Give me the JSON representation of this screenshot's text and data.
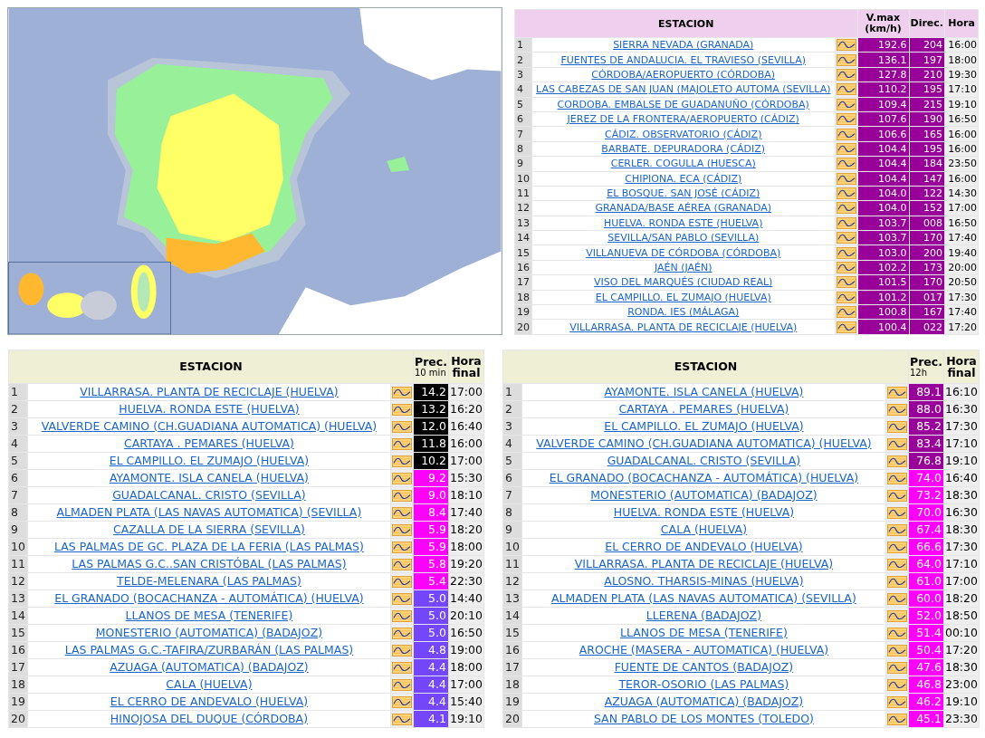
{
  "tables": [
    {
      "kind": "wind",
      "columns": [
        {
          "label": "ESTACION"
        },
        {
          "label": "V.max",
          "sub": "(km/h)"
        },
        {
          "label": "Direc."
        },
        {
          "label": "Hora"
        }
      ],
      "rows": [
        {
          "n": "1",
          "station": "SIERRA NEVADA (GRANADA)",
          "value": "192.6",
          "dir": "204",
          "time": "16:00",
          "color": "#990099"
        },
        {
          "n": "2",
          "station": "FUENTES DE ANDALUCIA. EL TRAVIESO (SEVILLA)",
          "value": "136.1",
          "dir": "197",
          "time": "18:00",
          "color": "#990099"
        },
        {
          "n": "3",
          "station": "CÓRDOBA/AEROPUERTO (CÓRDOBA)",
          "value": "127.8",
          "dir": "210",
          "time": "19:30",
          "color": "#990099"
        },
        {
          "n": "4",
          "station": "LAS CABEZAS DE SAN JUAN (MAJOLETO AUTOMA (SEVILLA)",
          "value": "110.2",
          "dir": "195",
          "time": "17:10",
          "color": "#990099"
        },
        {
          "n": "5",
          "station": "CORDOBA. EMBALSE DE GUADANUÑO (CÓRDOBA)",
          "value": "109.4",
          "dir": "215",
          "time": "19:10",
          "color": "#990099"
        },
        {
          "n": "6",
          "station": "JEREZ DE LA FRONTERA/AEROPUERTO (CÁDIZ)",
          "value": "107.6",
          "dir": "190",
          "time": "16:50",
          "color": "#990099"
        },
        {
          "n": "7",
          "station": "CÁDIZ. OBSERVATORIO (CÁDIZ)",
          "value": "106.6",
          "dir": "165",
          "time": "16:00",
          "color": "#990099"
        },
        {
          "n": "8",
          "station": "BARBATE. DEPURADORA (CÁDIZ)",
          "value": "104.4",
          "dir": "195",
          "time": "16:00",
          "color": "#990099"
        },
        {
          "n": "9",
          "station": "CERLER. COGULLA (HUESCA)",
          "value": "104.4",
          "dir": "184",
          "time": "23:50",
          "color": "#990099"
        },
        {
          "n": "10",
          "station": "CHIPIONA. ECA (CÁDIZ)",
          "value": "104.4",
          "dir": "147",
          "time": "16:00",
          "color": "#990099"
        },
        {
          "n": "11",
          "station": "EL BOSQUE. SAN JOSÉ (CÁDIZ)",
          "value": "104.0",
          "dir": "122",
          "time": "14:30",
          "color": "#990099"
        },
        {
          "n": "12",
          "station": "GRANADA/BASE AÉREA (GRANADA)",
          "value": "104.0",
          "dir": "152",
          "time": "17:00",
          "color": "#990099"
        },
        {
          "n": "13",
          "station": "HUELVA. RONDA ESTE (HUELVA)",
          "value": "103.7",
          "dir": "008",
          "time": "16:50",
          "color": "#990099"
        },
        {
          "n": "14",
          "station": "SEVILLA/SAN PABLO (SEVILLA)",
          "value": "103.7",
          "dir": "170",
          "time": "17:40",
          "color": "#990099"
        },
        {
          "n": "15",
          "station": "VILLANUEVA DE CÓRDOBA (CÓRDOBA)",
          "value": "103.0",
          "dir": "200",
          "time": "19:40",
          "color": "#990099"
        },
        {
          "n": "16",
          "station": "JAÉN (JAÉN)",
          "value": "102.2",
          "dir": "173",
          "time": "20:00",
          "color": "#990099"
        },
        {
          "n": "17",
          "station": "VISO DEL MARQUÉS (CIUDAD REAL)",
          "value": "101.5",
          "dir": "170",
          "time": "20:50",
          "color": "#990099"
        },
        {
          "n": "18",
          "station": "EL CAMPILLO. EL ZUMAJO (HUELVA)",
          "value": "101.2",
          "dir": "017",
          "time": "17:30",
          "color": "#990099"
        },
        {
          "n": "19",
          "station": "RONDA. IES (MÁLAGA)",
          "value": "100.8",
          "dir": "167",
          "time": "17:40",
          "color": "#990099"
        },
        {
          "n": "20",
          "station": "VILLARRASA. PLANTA DE RECICLAJE (HUELVA)",
          "value": "100.4",
          "dir": "022",
          "time": "17:20",
          "color": "#990099"
        }
      ]
    },
    {
      "kind": "precip",
      "columns": [
        {
          "label": "ESTACION"
        },
        {
          "label": "Prec.",
          "sub": "10 min"
        },
        {
          "label": "Hora final"
        }
      ],
      "rows": [
        {
          "n": "1",
          "station": "VILLARRASA. PLANTA DE RECICLAJE (HUELVA)",
          "value": "14.2",
          "time": "17:00",
          "color": "#000000"
        },
        {
          "n": "2",
          "station": "HUELVA. RONDA ESTE (HUELVA)",
          "value": "13.2",
          "time": "16:20",
          "color": "#000000"
        },
        {
          "n": "3",
          "station": "VALVERDE CAMINO (CH.GUADIANA AUTOMATICA) (HUELVA)",
          "value": "12.0",
          "time": "16:40",
          "color": "#000000"
        },
        {
          "n": "4",
          "station": "CARTAYA . PEMARES (HUELVA)",
          "value": "11.8",
          "time": "16:00",
          "color": "#000000"
        },
        {
          "n": "5",
          "station": "EL CAMPILLO. EL ZUMAJO (HUELVA)",
          "value": "10.2",
          "time": "17:00",
          "color": "#000000"
        },
        {
          "n": "6",
          "station": "AYAMONTE. ISLA CANELA (HUELVA)",
          "value": "9.2",
          "time": "15:30",
          "color": "#ff00ff"
        },
        {
          "n": "7",
          "station": "GUADALCANAL. CRISTO (SEVILLA)",
          "value": "9.0",
          "time": "18:10",
          "color": "#ff00ff"
        },
        {
          "n": "8",
          "station": "ALMADEN PLATA (LAS NAVAS AUTOMATICA) (SEVILLA)",
          "value": "8.4",
          "time": "17:40",
          "color": "#ff00ff"
        },
        {
          "n": "9",
          "station": "CAZALLA DE LA SIERRA (SEVILLA)",
          "value": "5.9",
          "time": "18:20",
          "color": "#ff00ff"
        },
        {
          "n": "10",
          "station": "LAS PALMAS DE GC. PLAZA DE LA FERIA (LAS PALMAS)",
          "value": "5.9",
          "time": "18:00",
          "color": "#ff00ff"
        },
        {
          "n": "11",
          "station": "LAS PALMAS G.C..SAN CRISTÓBAL (LAS PALMAS)",
          "value": "5.8",
          "time": "19:20",
          "color": "#ff00ff"
        },
        {
          "n": "12",
          "station": "TELDE-MELENARA (LAS PALMAS)",
          "value": "5.4",
          "time": "22:30",
          "color": "#ff00ff"
        },
        {
          "n": "13",
          "station": "EL GRANADO (BOCACHANZA - AUTOMÁTICA) (HUELVA)",
          "value": "5.0",
          "time": "14:40",
          "color": "#7447ff"
        },
        {
          "n": "14",
          "station": "LLANOS DE MESA (TENERIFE)",
          "value": "5.0",
          "time": "20:10",
          "color": "#7447ff"
        },
        {
          "n": "15",
          "station": "MONESTERIO (AUTOMATICA) (BADAJOZ)",
          "value": "5.0",
          "time": "16:50",
          "color": "#7447ff"
        },
        {
          "n": "16",
          "station": "LAS PALMAS G.C.-TAFIRA/ZURBARÁN (LAS PALMAS)",
          "value": "4.8",
          "time": "19:00",
          "color": "#7447ff"
        },
        {
          "n": "17",
          "station": "AZUAGA (AUTOMATICA) (BADAJOZ)",
          "value": "4.4",
          "time": "18:00",
          "color": "#7447ff"
        },
        {
          "n": "18",
          "station": "CALA (HUELVA)",
          "value": "4.4",
          "time": "17:00",
          "color": "#7447ff"
        },
        {
          "n": "19",
          "station": "EL CERRO DE ANDEVALO (HUELVA)",
          "value": "4.4",
          "time": "15:40",
          "color": "#7447ff"
        },
        {
          "n": "20",
          "station": "HINOJOSA DEL DUQUE (CÓRDOBA)",
          "value": "4.1",
          "time": "19:10",
          "color": "#7447ff"
        }
      ]
    },
    {
      "kind": "precip",
      "columns": [
        {
          "label": "ESTACION"
        },
        {
          "label": "Prec.",
          "sub": "12h"
        },
        {
          "label": "Hora final"
        }
      ],
      "rows": [
        {
          "n": "1",
          "station": "AYAMONTE. ISLA CANELA (HUELVA)",
          "value": "89.1",
          "time": "16:10",
          "color": "#990099"
        },
        {
          "n": "2",
          "station": "CARTAYA . PEMARES (HUELVA)",
          "value": "88.0",
          "time": "16:30",
          "color": "#990099"
        },
        {
          "n": "3",
          "station": "EL CAMPILLO. EL ZUMAJO (HUELVA)",
          "value": "85.2",
          "time": "17:30",
          "color": "#990099"
        },
        {
          "n": "4",
          "station": "VALVERDE CAMINO (CH.GUADIANA AUTOMATICA) (HUELVA)",
          "value": "83.4",
          "time": "17:10",
          "color": "#990099"
        },
        {
          "n": "5",
          "station": "GUADALCANAL. CRISTO (SEVILLA)",
          "value": "76.8",
          "time": "19:10",
          "color": "#990099"
        },
        {
          "n": "6",
          "station": "EL GRANADO (BOCACHANZA - AUTOMÁTICA) (HUELVA)",
          "value": "74.0",
          "time": "16:40",
          "color": "#ff00ff"
        },
        {
          "n": "7",
          "station": "MONESTERIO (AUTOMATICA) (BADAJOZ)",
          "value": "73.2",
          "time": "18:30",
          "color": "#ff00ff"
        },
        {
          "n": "8",
          "station": "HUELVA. RONDA ESTE (HUELVA)",
          "value": "70.0",
          "time": "16:30",
          "color": "#ff00ff"
        },
        {
          "n": "9",
          "station": "CALA (HUELVA)",
          "value": "67.4",
          "time": "18:30",
          "color": "#ff00ff"
        },
        {
          "n": "10",
          "station": "EL CERRO DE ANDEVALO (HUELVA)",
          "value": "66.6",
          "time": "17:30",
          "color": "#ff00ff"
        },
        {
          "n": "11",
          "station": "VILLARRASA. PLANTA DE RECICLAJE (HUELVA)",
          "value": "64.0",
          "time": "17:10",
          "color": "#ff00ff"
        },
        {
          "n": "12",
          "station": "ALOSNO. THARSIS-MINAS (HUELVA)",
          "value": "61.0",
          "time": "17:00",
          "color": "#ff00ff"
        },
        {
          "n": "13",
          "station": "ALMADEN PLATA (LAS NAVAS AUTOMATICA) (SEVILLA)",
          "value": "60.0",
          "time": "18:20",
          "color": "#ff00ff"
        },
        {
          "n": "14",
          "station": "LLERENA (BADAJOZ)",
          "value": "52.0",
          "time": "18:50",
          "color": "#ff00ff"
        },
        {
          "n": "15",
          "station": "LLANOS DE MESA (TENERIFE)",
          "value": "51.4",
          "time": "00:10",
          "color": "#ff00ff"
        },
        {
          "n": "16",
          "station": "AROCHE (MASERA - AUTOMATICA) (HUELVA)",
          "value": "50.4",
          "time": "17:20",
          "color": "#ff00ff"
        },
        {
          "n": "17",
          "station": "FUENTE DE CANTOS (BADAJOZ)",
          "value": "47.6",
          "time": "18:30",
          "color": "#ff00ff"
        },
        {
          "n": "18",
          "station": "TEROR-OSORIO (LAS PALMAS)",
          "value": "46.8",
          "time": "23:00",
          "color": "#ff00ff"
        },
        {
          "n": "19",
          "station": "AZUAGA (AUTOMATICA) (BADAJOZ)",
          "value": "46.2",
          "time": "19:10",
          "color": "#ff00ff"
        },
        {
          "n": "20",
          "station": "SAN PABLO DE LOS MONTES (TOLEDO)",
          "value": "45.1",
          "time": "23:30",
          "color": "#ff00ff"
        }
      ]
    }
  ]
}
